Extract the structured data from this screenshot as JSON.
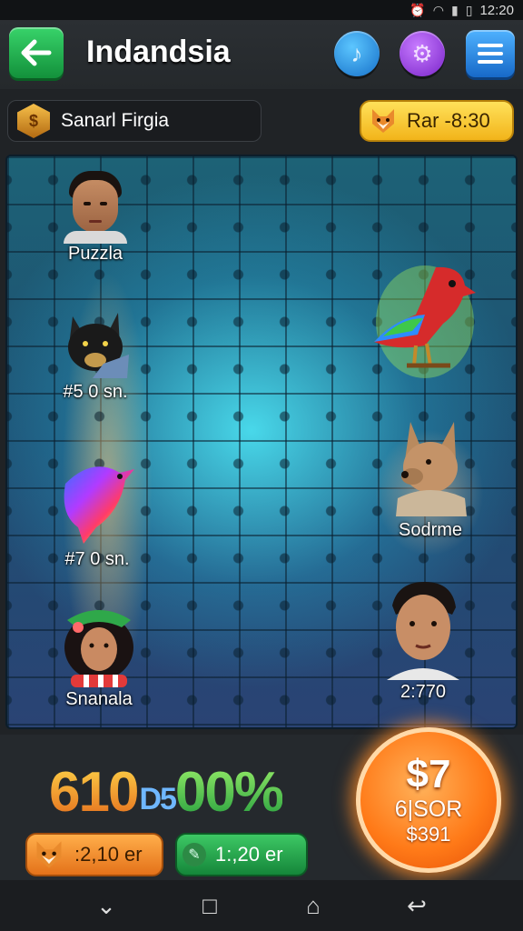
{
  "status_bar": {
    "time": "12:20"
  },
  "header": {
    "title": "Indandsia",
    "back_icon": "arrow-left-icon",
    "music_icon": "music-note-icon",
    "settings_icon": "gear-icon",
    "menu_icon": "hamburger-menu-icon"
  },
  "info": {
    "player_name": "Sanarl Firgia",
    "timer": "Rar -8:30"
  },
  "board": {
    "tokens": [
      {
        "kind": "portrait-man",
        "label": "Puzzla"
      },
      {
        "kind": "black-cat",
        "label": "#5 0 sn."
      },
      {
        "kind": "rainbow-eagle",
        "label": "#7 0 sn."
      },
      {
        "kind": "girl-green-hat",
        "label": "Snanala"
      },
      {
        "kind": "red-parrot",
        "label": ""
      },
      {
        "kind": "dog-sweater",
        "label": "Sodrme"
      },
      {
        "kind": "portrait-young-man",
        "label": "2:770"
      }
    ]
  },
  "bottom": {
    "score_a": "610",
    "score_b": "D5",
    "score_c": "00%",
    "chip_orange": ":2,10 er",
    "chip_green": "1:,20 er",
    "prize_big": "$7",
    "prize_mid": "6|SOR",
    "prize_small": "$391"
  },
  "colors": {
    "accent_green": "#13913b",
    "accent_gold": "#f2b41a",
    "accent_orange": "#ff7a18",
    "board_glow": "#50f0ff"
  }
}
